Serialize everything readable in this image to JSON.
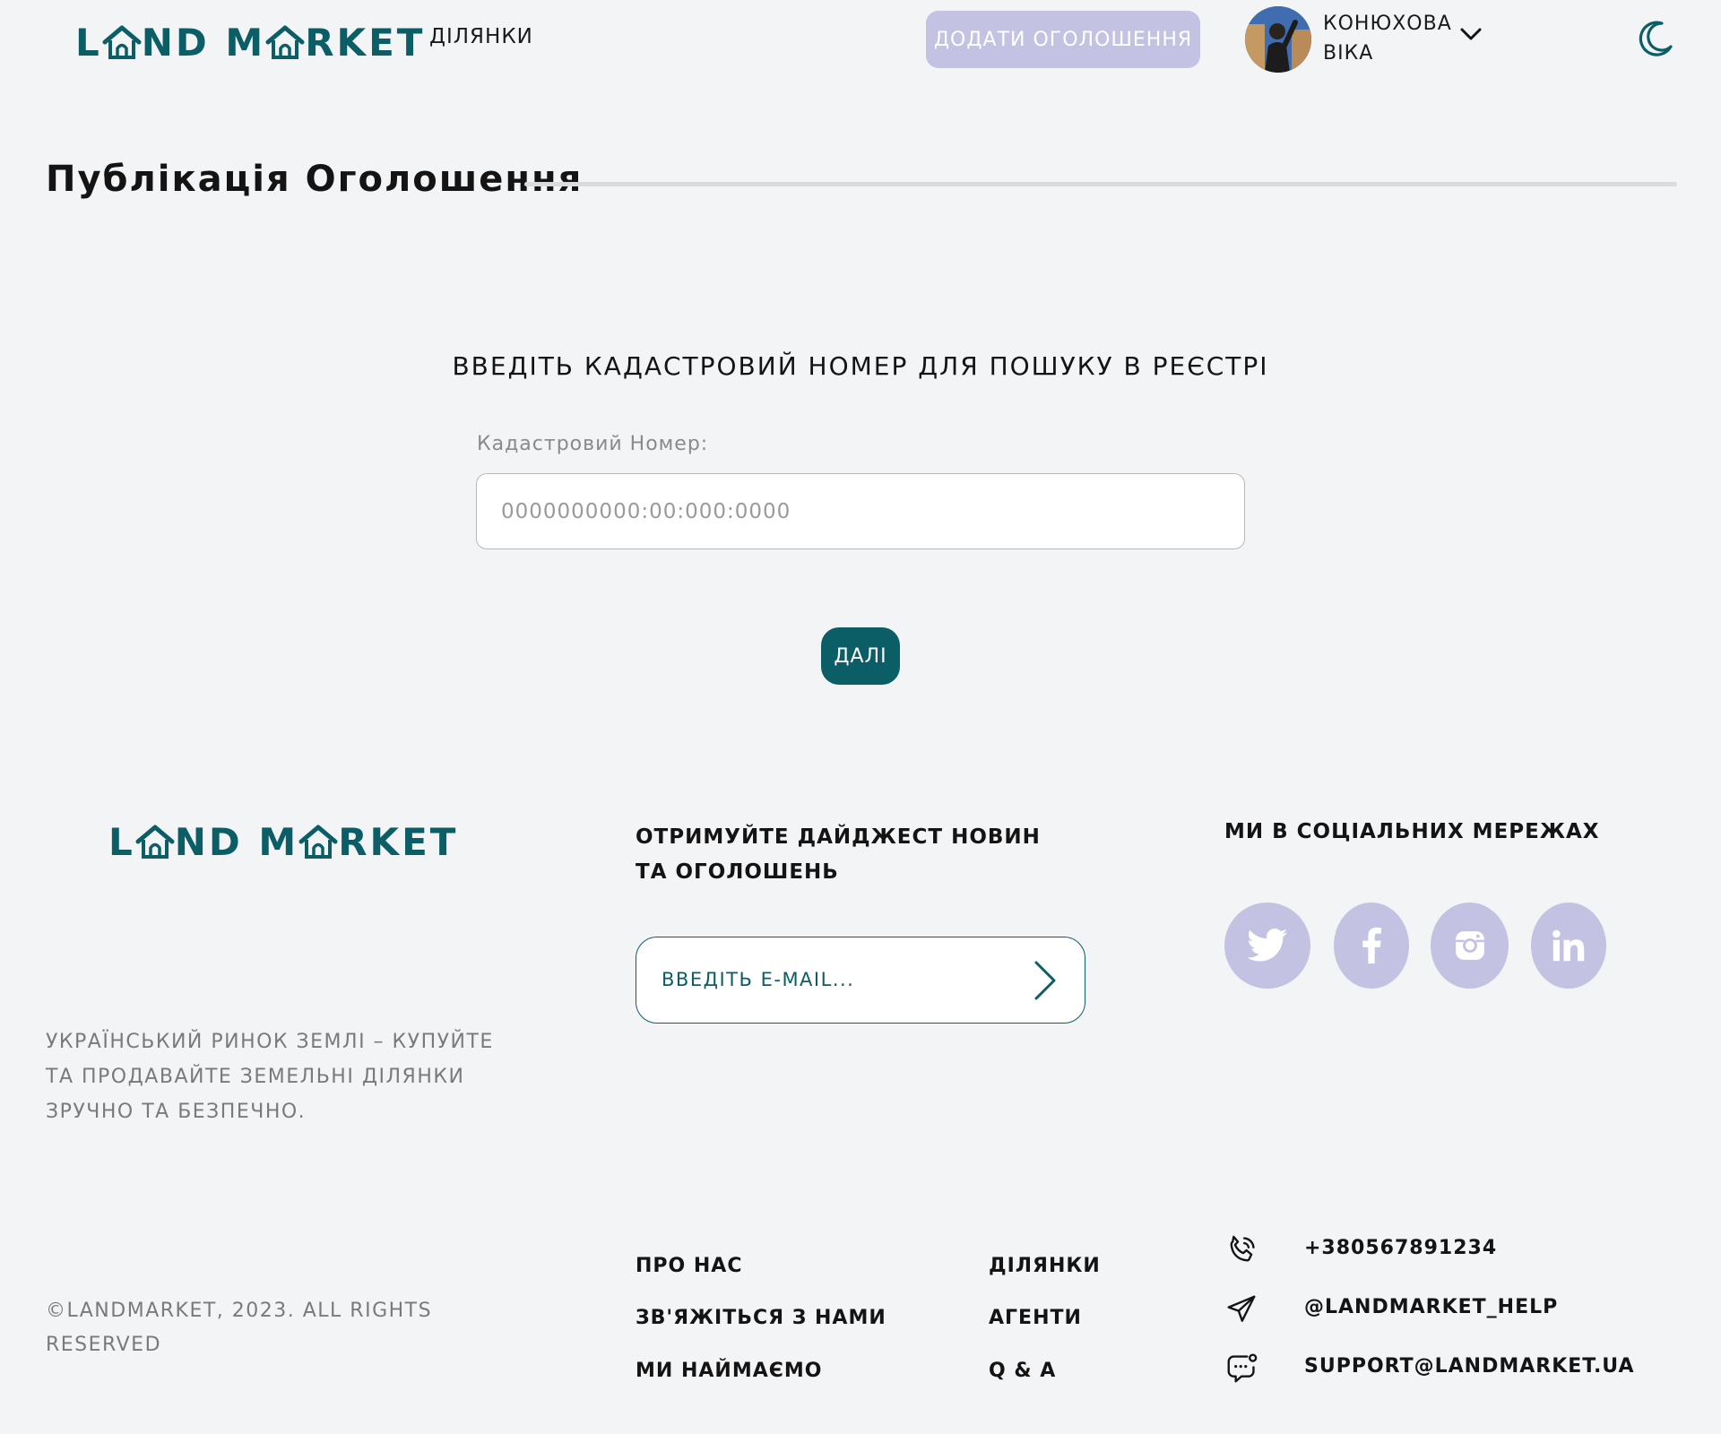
{
  "colors": {
    "brand": "#0b5e66",
    "accent": "#c3c2e3",
    "background": "#f3f4f6"
  },
  "header": {
    "logo": {
      "left": "L",
      "mid": "ND M",
      "right": "RKET"
    },
    "nav_link": "ДІЛЯНКИ",
    "add_listing": "ДОДАТИ ОГОЛОШЕННЯ",
    "user": {
      "line1": "КОНЮХОВА",
      "line2": "ВІКА"
    }
  },
  "page": {
    "title": "Публікація Оголошення"
  },
  "form": {
    "heading": "ВВЕДІТЬ КАДАСТРОВИЙ НОМЕР ДЛЯ ПОШУКУ В РЕЄСТРІ",
    "label": "Кадастровий Номер:",
    "placeholder": "0000000000:00:000:0000",
    "submit": "ДАЛІ"
  },
  "footer": {
    "logo": {
      "left": "L",
      "mid": "ND M",
      "right": "RKET"
    },
    "description": "УКРАЇНСЬКИЙ РИНОК ЗЕМЛІ – КУПУЙТЕ ТА ПРОДАВАЙТЕ ЗЕМЕЛЬНІ ДІЛЯНКИ ЗРУЧНО ТА БЕЗПЕЧНО.",
    "digest_title": "ОТРИМУЙТЕ ДАЙДЖЕСТ НОВИН ТА ОГОЛОШЕНЬ",
    "email_placeholder": "ВВЕДІТЬ E-MAIL...",
    "social_title": "МИ В СОЦІАЛЬНИХ МЕРЕЖАХ",
    "social": [
      "twitter-icon",
      "facebook-icon",
      "instagram-icon",
      "linkedin-icon"
    ],
    "links": {
      "about": "ПРО НАС",
      "contact": "ЗВ'ЯЖІТЬСЯ З НАМИ",
      "hiring": "МИ НАЙМАЄМО",
      "plots": "ДІЛЯНКИ",
      "agents": "АГЕНТИ",
      "qa": "Q & A"
    },
    "contacts": {
      "phone": "+380567891234",
      "telegram": "@LANDMARKET_HELP",
      "email": "SUPPORT@LANDMARKET.UA"
    },
    "copyright": "©LANDMARKET, 2023. ALL RIGHTS RESERVED"
  }
}
